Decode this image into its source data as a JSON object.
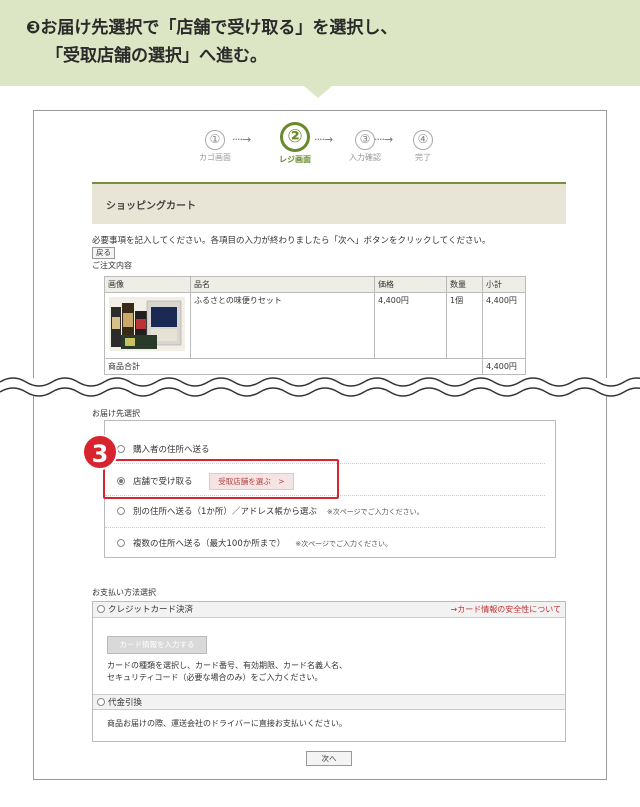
{
  "instruction": {
    "marker": "❸",
    "line1": "お届け先選択で「店舗で受け取る」を選択し、",
    "line2": "「受取店舗の選択」へ進む。"
  },
  "steps": [
    {
      "num": "①",
      "label": "カゴ画面"
    },
    {
      "num": "②",
      "label": "レジ画面"
    },
    {
      "num": "③",
      "label": "入力確認"
    },
    {
      "num": "④",
      "label": "完了"
    }
  ],
  "step_arrow": "····→",
  "cart": {
    "title": "ショッピングカート",
    "instruction": "必要事項を記入してください。各項目の入力が終わりましたら「次へ」ボタンをクリックしてください。",
    "back_label": "戻る",
    "order_title": "ご注文内容",
    "headers": [
      "画像",
      "品名",
      "価格",
      "数量",
      "小計"
    ],
    "item": {
      "name": "ふるさとの味便りセット",
      "price": "4,400円",
      "qty": "1個",
      "subtotal": "4,400円"
    },
    "total_label": "商品合計",
    "total_value": "4,400円"
  },
  "shipping": {
    "title": "お届け先選択",
    "options": [
      {
        "label": "購入者の住所へ送る",
        "note": ""
      },
      {
        "label": "店舗で受け取る",
        "note": ""
      },
      {
        "label": "別の住所へ送る（1か所）／アドレス帳から選ぶ",
        "note": "※次ページでご入力ください。"
      },
      {
        "label": "複数の住所へ送る（最大100か所まで）",
        "note": "※次ページでご入力ください。"
      }
    ],
    "store_button": "受取店舗を選ぶ　>",
    "badge": "3"
  },
  "payment": {
    "title": "お支払い方法選択",
    "credit_label": "クレジットカード決済",
    "security_link": "→カード情報の安全性について",
    "card_button": "カード情報を入力する",
    "credit_desc1": "カードの種類を選択し、カード番号、有効期限、カード名義人名、",
    "credit_desc2": "セキュリティコード（必要な場合のみ）をご入力ください。",
    "cod_label": "代金引換",
    "cod_desc": "商品お届けの際、運送会社のドライバーに直接お支払いください。"
  },
  "next_label": "次へ",
  "colors": {
    "accent": "#6a8a2a",
    "highlight": "#d7242f",
    "banner": "#dde6c4"
  }
}
